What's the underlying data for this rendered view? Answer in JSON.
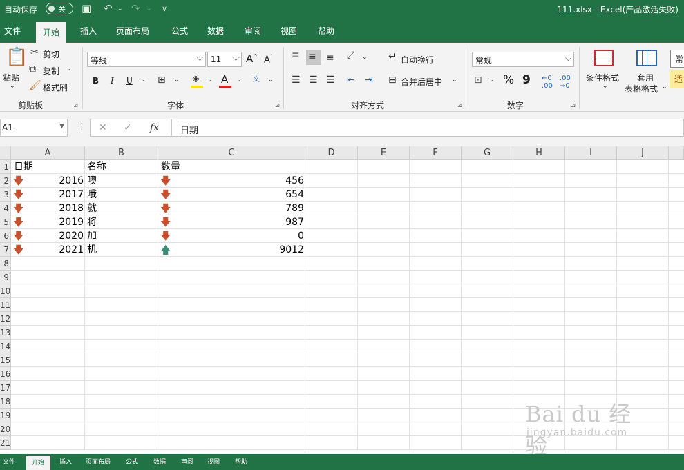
{
  "titlebar": {
    "autosave_label": "自动保存",
    "autosave_state": "关",
    "title": "111.xlsx  -  Excel(产品激活失败)"
  },
  "tabs": [
    "文件",
    "开始",
    "插入",
    "页面布局",
    "公式",
    "数据",
    "审阅",
    "视图",
    "帮助"
  ],
  "active_tab": "开始",
  "ribbon": {
    "clipboard": {
      "paste": "粘贴",
      "cut": "剪切",
      "copy": "复制",
      "format_painter": "格式刷",
      "label": "剪贴板"
    },
    "font": {
      "name": "等线",
      "size": "11",
      "bold": "B",
      "italic": "I",
      "underline": "U",
      "label": "字体"
    },
    "alignment": {
      "wrap": "自动换行",
      "merge": "合并后居中",
      "label": "对齐方式"
    },
    "number": {
      "format": "常规",
      "percent": "%",
      "comma": "9",
      "label": "数字"
    },
    "styles": {
      "conditional": "条件格式",
      "table_format_line1": "套用",
      "table_format_line2": "表格格式",
      "partial": "常",
      "partial2": "适"
    }
  },
  "formula_bar": {
    "name_box": "A1",
    "formula": "日期"
  },
  "sheet": {
    "columns": [
      "A",
      "B",
      "C",
      "D",
      "E",
      "F",
      "G",
      "H",
      "I",
      "J"
    ],
    "row_numbers": [
      "1",
      "2",
      "3",
      "4",
      "5",
      "6",
      "7",
      "8",
      "9",
      "10",
      "11",
      "12",
      "13",
      "14",
      "15",
      "16",
      "17",
      "18",
      "19",
      "20",
      "21"
    ],
    "header": {
      "a": "日期",
      "b": "名称",
      "c": "数量"
    },
    "rows": [
      {
        "year": "2016",
        "name": "噢",
        "qty": "456",
        "a_arrow": "down",
        "c_arrow": "down"
      },
      {
        "year": "2017",
        "name": "哦",
        "qty": "654",
        "a_arrow": "down",
        "c_arrow": "down"
      },
      {
        "year": "2018",
        "name": "就",
        "qty": "789",
        "a_arrow": "down",
        "c_arrow": "down"
      },
      {
        "year": "2019",
        "name": "将",
        "qty": "987",
        "a_arrow": "down",
        "c_arrow": "down"
      },
      {
        "year": "2020",
        "name": "加",
        "qty": "0",
        "a_arrow": "down",
        "c_arrow": "down"
      },
      {
        "year": "2021",
        "name": "机",
        "qty": "9012",
        "a_arrow": "down",
        "c_arrow": "up"
      }
    ]
  },
  "watermark": {
    "brand": "Bai du 经验",
    "url": "jingyan.baidu.com"
  },
  "colors": {
    "excel_green": "#217346",
    "arrow_down": "#c8502c",
    "arrow_up": "#3a8a7a"
  }
}
